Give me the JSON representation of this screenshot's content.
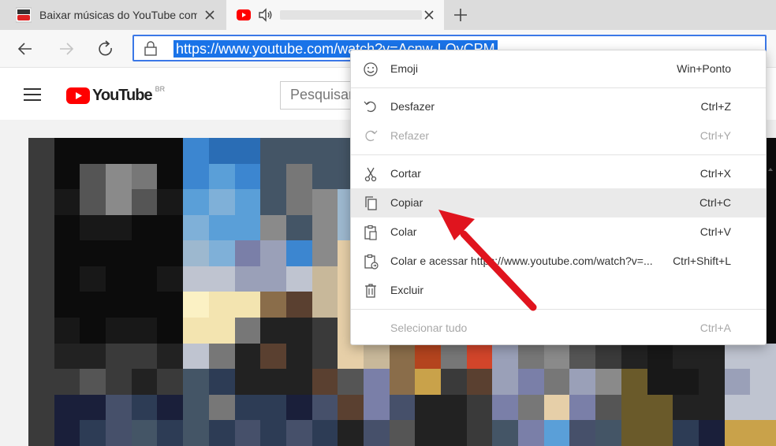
{
  "browser": {
    "tabs": [
      {
        "title": "Baixar músicas do YouTube com",
        "favicon": "youtube-logo-icon"
      },
      {
        "title": "",
        "favicon": "youtube-play-icon",
        "audio_icon": "speaker-icon"
      }
    ],
    "new_tab_icon": "plus-icon",
    "close_icon": "close-icon",
    "nav": {
      "back_icon": "arrow-left-icon",
      "forward_icon": "arrow-right-icon",
      "refresh_icon": "refresh-icon"
    },
    "address": {
      "lock_icon": "lock-icon",
      "url": "https://www.youtube.com/watch?v=Acnw-LQyCPM"
    }
  },
  "youtube": {
    "logo_text": "YouTube",
    "region": "BR",
    "search_placeholder": "Pesquisar",
    "menu_icon": "hamburger-icon"
  },
  "context_menu": {
    "groups": [
      [
        {
          "icon": "emoji-icon",
          "label": "Emoji",
          "shortcut": "Win+Ponto",
          "disabled": false
        }
      ],
      [
        {
          "icon": "undo-icon",
          "label": "Desfazer",
          "shortcut": "Ctrl+Z",
          "disabled": false
        },
        {
          "icon": "redo-icon",
          "label": "Refazer",
          "shortcut": "Ctrl+Y",
          "disabled": true
        }
      ],
      [
        {
          "icon": "scissors-icon",
          "label": "Cortar",
          "shortcut": "Ctrl+X",
          "disabled": false
        },
        {
          "icon": "copy-icon",
          "label": "Copiar",
          "shortcut": "Ctrl+C",
          "disabled": false,
          "highlighted": true
        },
        {
          "icon": "paste-icon",
          "label": "Colar",
          "shortcut": "Ctrl+V",
          "disabled": false
        },
        {
          "icon": "paste-go-icon",
          "label": "Colar e acessar https://www.youtube.com/watch?v=...",
          "shortcut": "Ctrl+Shift+L",
          "disabled": false
        },
        {
          "icon": "trash-icon",
          "label": "Excluir",
          "shortcut": "",
          "disabled": false
        }
      ],
      [
        {
          "icon": "",
          "label": "Selecionar tudo",
          "shortcut": "Ctrl+A",
          "disabled": true
        }
      ]
    ]
  },
  "colors": {
    "accent": "#1a73e8",
    "youtube_red": "#ff0000",
    "annotation_arrow": "#e0141e",
    "menu_highlight": "#eaeaea"
  }
}
